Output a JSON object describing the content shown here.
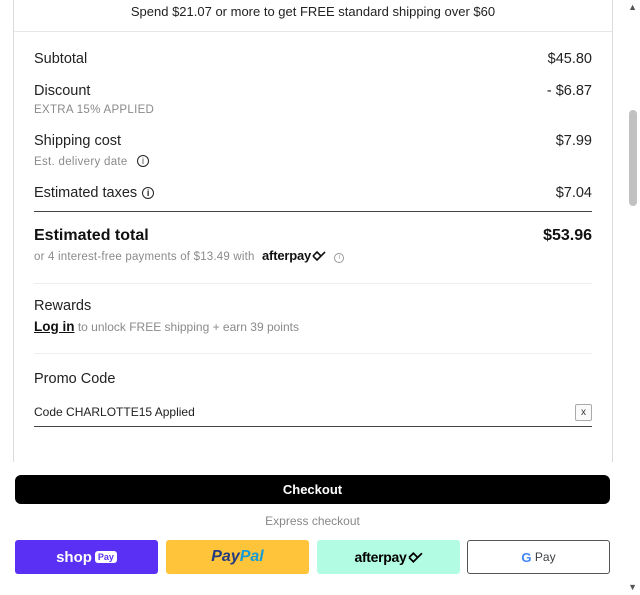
{
  "banner": {
    "text": "Spend $21.07 or more to get FREE standard shipping over $60"
  },
  "summary": {
    "subtotal": {
      "label": "Subtotal",
      "value": "$45.80"
    },
    "discount": {
      "label": "Discount",
      "value": "- $6.87",
      "note": "EXTRA 15% APPLIED"
    },
    "shipping": {
      "label": "Shipping cost",
      "value": "$7.99",
      "note": "Est. delivery date"
    },
    "taxes": {
      "label": "Estimated taxes",
      "value": "$7.04"
    },
    "total": {
      "label": "Estimated total",
      "value": "$53.96",
      "installments_text": "or 4 interest-free payments of $13.49 with",
      "afterpay_brand": "afterpay"
    }
  },
  "rewards": {
    "title": "Rewards",
    "login_label": "Log in",
    "text": "to unlock FREE shipping + earn 39 points"
  },
  "promo": {
    "title": "Promo Code",
    "applied_text": "Code CHARLOTTE15 Applied",
    "remove_label": "x"
  },
  "actions": {
    "checkout_label": "Checkout",
    "express_label": "Express checkout",
    "shop_pay": {
      "word": "shop",
      "badge": "Pay"
    },
    "paypal": {
      "part1": "Pay",
      "part2": "Pal"
    },
    "afterpay": "afterpay",
    "gpay": {
      "g": "G",
      "pay": "Pay"
    }
  },
  "icons": {
    "info": "info-circle-icon",
    "afterpay_loop": "afterpay-arrows-icon"
  },
  "colors": {
    "shop_pay": "#5a31f4",
    "paypal": "#ffc439",
    "afterpay": "#b2fce4",
    "checkout": "#000000"
  }
}
